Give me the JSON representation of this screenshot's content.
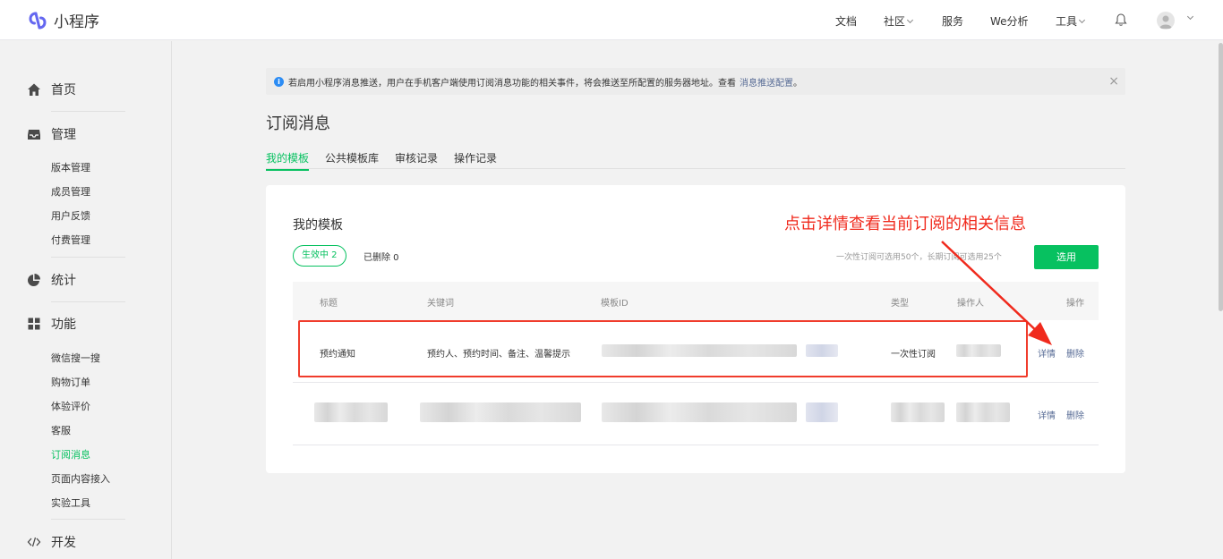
{
  "header": {
    "app_name": "小程序",
    "nav": [
      "文档",
      "社区",
      "服务",
      "We分析",
      "工具"
    ]
  },
  "sidebar": {
    "home": "首页",
    "manage": {
      "label": "管理",
      "items": [
        "版本管理",
        "成员管理",
        "用户反馈",
        "付费管理"
      ]
    },
    "stats": "统计",
    "features": {
      "label": "功能",
      "items": [
        "微信搜一搜",
        "购物订单",
        "体验评价",
        "客服",
        "订阅消息",
        "页面内容接入",
        "实验工具"
      ]
    },
    "dev": "开发"
  },
  "notice": {
    "text": "若启用小程序消息推送，用户在手机客户端使用订阅消息功能的相关事件，将会推送至所配置的服务器地址。查看",
    "link": "消息推送配置",
    "suffix": "。"
  },
  "page": {
    "title": "订阅消息",
    "tabs": [
      "我的模板",
      "公共模板库",
      "审核记录",
      "操作记录"
    ]
  },
  "card": {
    "title": "我的模板",
    "active_label": "生效中 2",
    "deleted_label": "已删除 0",
    "quota": "一次性订阅可选用50个，长期订阅可选用25个",
    "select_button": "选用",
    "columns": [
      "标题",
      "关键词",
      "模板ID",
      "类型",
      "操作人",
      "操作"
    ],
    "rows": [
      {
        "title": "预约通知",
        "keywords": "预约人、预约时间、备注、温馨提示",
        "type": "一次性订阅",
        "detail": "详情",
        "delete": "删除"
      },
      {
        "detail": "详情",
        "delete": "删除"
      }
    ]
  },
  "annotation": {
    "text": "点击详情查看当前订阅的相关信息",
    "color": "#f02a1d"
  },
  "colors": {
    "accent": "#07c160",
    "link": "#576b95"
  }
}
